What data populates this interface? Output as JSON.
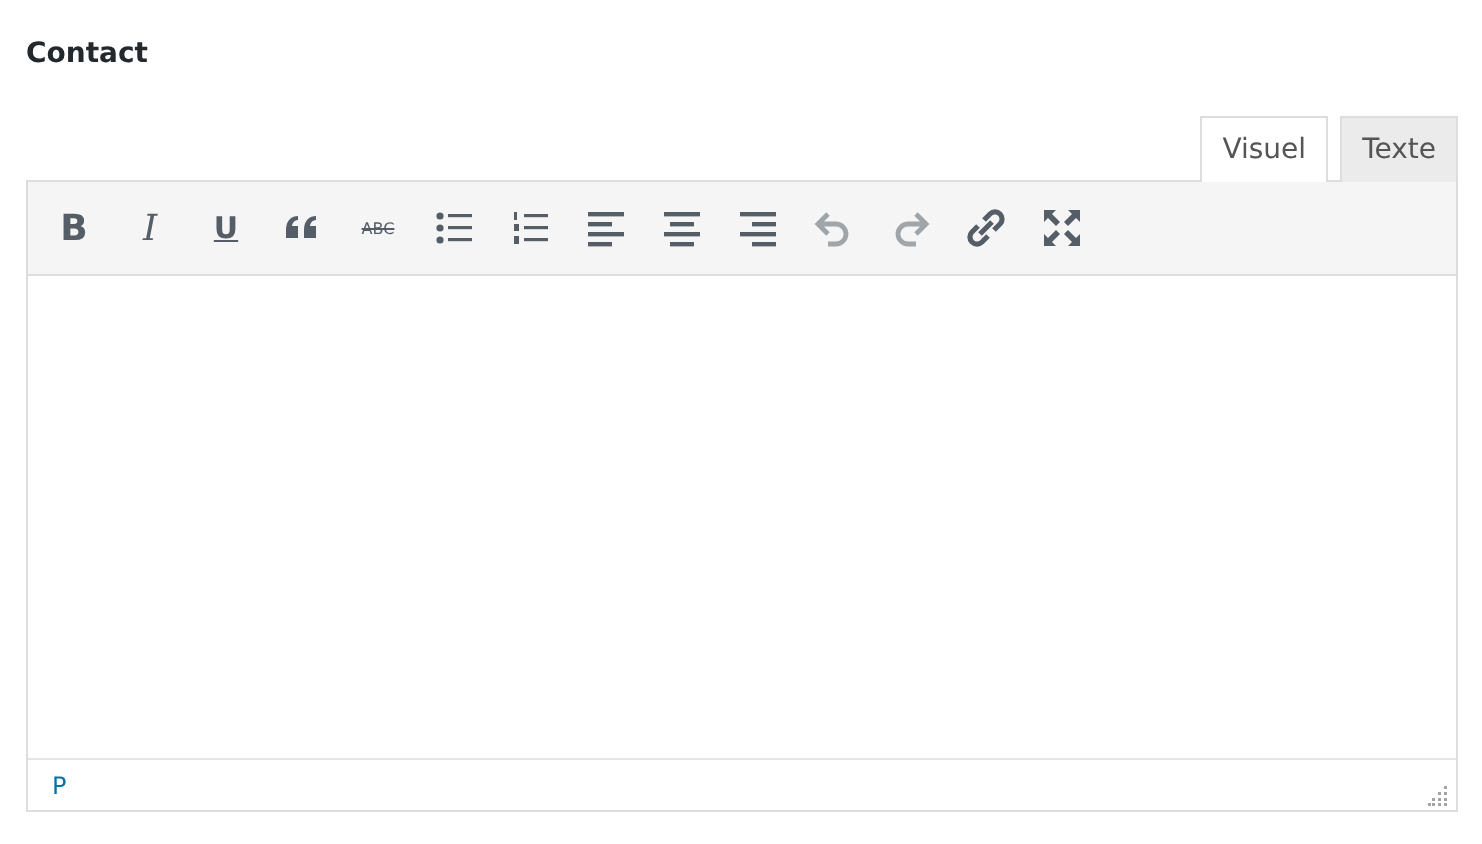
{
  "field": {
    "label": "Contact"
  },
  "tabs": [
    {
      "label": "Visuel",
      "selected": true
    },
    {
      "label": "Texte",
      "selected": false
    }
  ],
  "toolbar": [
    {
      "kind": "bold",
      "label": "B",
      "disabled": false
    },
    {
      "kind": "italic",
      "label": "I",
      "disabled": false
    },
    {
      "kind": "underline",
      "label": "U",
      "disabled": false
    },
    {
      "kind": "quote",
      "disabled": false
    },
    {
      "kind": "strike",
      "label": "ABC",
      "disabled": false
    },
    {
      "kind": "bullets",
      "disabled": false
    },
    {
      "kind": "numbers",
      "disabled": false
    },
    {
      "kind": "align-left",
      "disabled": false
    },
    {
      "kind": "align-center",
      "disabled": false
    },
    {
      "kind": "align-right",
      "disabled": false
    },
    {
      "kind": "undo",
      "disabled": true
    },
    {
      "kind": "redo",
      "disabled": true
    },
    {
      "kind": "link",
      "disabled": false
    },
    {
      "kind": "fullscreen",
      "disabled": false
    }
  ],
  "status_bar": {
    "path": "P"
  }
}
